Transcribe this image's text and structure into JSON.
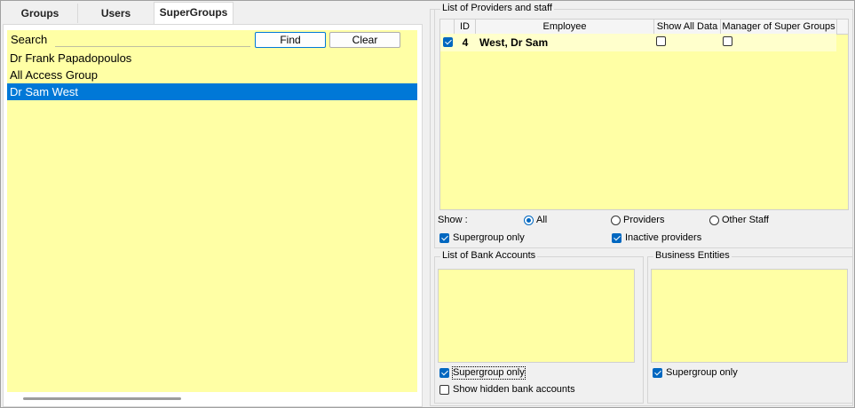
{
  "tabs": [
    {
      "label": "Groups"
    },
    {
      "label": "Users"
    },
    {
      "label": "SuperGroups"
    }
  ],
  "search": {
    "label": "Search",
    "value": "",
    "find_label": "Find",
    "clear_label": "Clear"
  },
  "supergroups": {
    "items": [
      {
        "label": "Dr Frank Papadopoulos"
      },
      {
        "label": "All Access Group"
      },
      {
        "label": "Dr Sam West",
        "selected": true
      }
    ]
  },
  "providers": {
    "title": "List of Providers and staff",
    "columns": [
      "ID",
      "Employee",
      "Show All Data",
      "Manager of Super Groups"
    ],
    "rows": [
      {
        "checked": true,
        "id": "4",
        "employee": "West, Dr Sam",
        "show_all_data": false,
        "manager": false
      }
    ],
    "show_label": "Show :",
    "show_options": [
      {
        "label": "All",
        "checked": true
      },
      {
        "label": "Providers",
        "checked": false
      },
      {
        "label": "Other Staff",
        "checked": false
      }
    ],
    "supergroup_only_label": "Supergroup only",
    "supergroup_only_checked": true,
    "inactive_label": "Inactive providers",
    "inactive_checked": true
  },
  "bank_accounts": {
    "title": "List of Bank Accounts",
    "supergroup_only_label": "Supergroup only",
    "supergroup_only_checked": true,
    "show_hidden_label": "Show hidden bank accounts",
    "show_hidden_checked": false
  },
  "business_entities": {
    "title": "Business Entities",
    "supergroup_only_label": "Supergroup only",
    "supergroup_only_checked": true
  },
  "colors": {
    "list_background": "#ffffa5",
    "selection": "#0078d7",
    "checkbox_accent": "#0067c0"
  }
}
